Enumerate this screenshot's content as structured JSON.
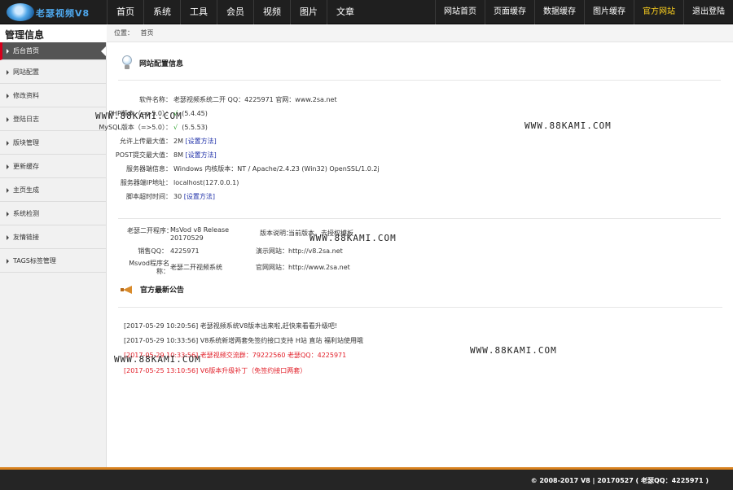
{
  "logo": {
    "text": "老瑟视频V8"
  },
  "nav_left": [
    "首页",
    "系统",
    "工具",
    "会员",
    "视频",
    "图片",
    "文章"
  ],
  "nav_right": [
    "网站首页",
    "页面缓存",
    "数据缓存",
    "图片缓存",
    "官方网站",
    "退出登陆"
  ],
  "side_title": "管理信息",
  "breadcrumb": {
    "label": "位置：",
    "current": "首页"
  },
  "sidebar": [
    "后台首页",
    "网站配置",
    "修改资料",
    "登陆日志",
    "版块管理",
    "更新缓存",
    "主页生成",
    "系统检测",
    "友情链接",
    "TAGS标签管理"
  ],
  "config": {
    "title": "网站配置信息",
    "rows": [
      {
        "label": "软件名称：",
        "value": "老瑟视频系统二开 QQ：4225971 官网：www.2sa.net"
      },
      {
        "label": "PHP版本（=>5.0）：",
        "check": "√",
        "value": "(5.4.45)"
      },
      {
        "label": "MySQL版本（=>5.0）：",
        "check": "√",
        "value": "(5.5.53)"
      },
      {
        "label": "允许上传最大值：",
        "value": "2M",
        "link": "[设置方法]"
      },
      {
        "label": "POST提交最大值：",
        "value": "8M",
        "link": "[设置方法]"
      },
      {
        "label": "服务器端信息：",
        "value": "Windows  内核版本：NT / Apache/2.4.23 (Win32) OpenSSL/1.0.2j"
      },
      {
        "label": "服务器端IP地址：",
        "value": "localhost(127.0.0.1)"
      },
      {
        "label": "脚本超时时间：",
        "value": "30",
        "link": "[设置方法]"
      }
    ]
  },
  "info": {
    "program_label": "老瑟二开程序：",
    "program_value": "MsVod v8 Release 20170529",
    "version_label": "版本说明：",
    "version_value": "当前版本，去授权模板",
    "sales_label": "销售QQ：",
    "sales_value": "4225971",
    "demo_label": "演示网站：",
    "demo_value": "http://v8.2sa.net",
    "name_label": "Msvod程序名称：",
    "name_value": "老瑟二开视频系统",
    "official_label": "官网网站：",
    "official_value": "http://www.2sa.net"
  },
  "news": {
    "title": "官方最新公告",
    "items": [
      {
        "text": "[2017-05-29 10:20:56] 老瑟视频系统V8版本出来啦,赶快来看看升级吧!",
        "color": "#333333"
      },
      {
        "text": "[2017-05-29 10:33:56] V8系统新增两套免签约接口支持 H站 直站 福利站使用哦",
        "color": "#333333"
      },
      {
        "text": "[2017-05-29 10:33:56] 老瑟视频交流群：79222560 老瑟QQ：4225971",
        "color": "#e2202a"
      },
      {
        "text": "[2017-05-25 13:10:56] V6版本升级补丁（免签约接口两套）",
        "color": "#e2202a"
      }
    ]
  },
  "watermark": "WWW.88KAMI.COM",
  "footer": "© 2008-2017  V8  | 20170527 ( 老瑟QQ：4225971 )",
  "colors": {
    "topbar": "#1f1f1f",
    "accent_active": "#ffd21f",
    "footer_border": "#d9821f",
    "red": "#e2202a",
    "link": "#2233aa"
  }
}
